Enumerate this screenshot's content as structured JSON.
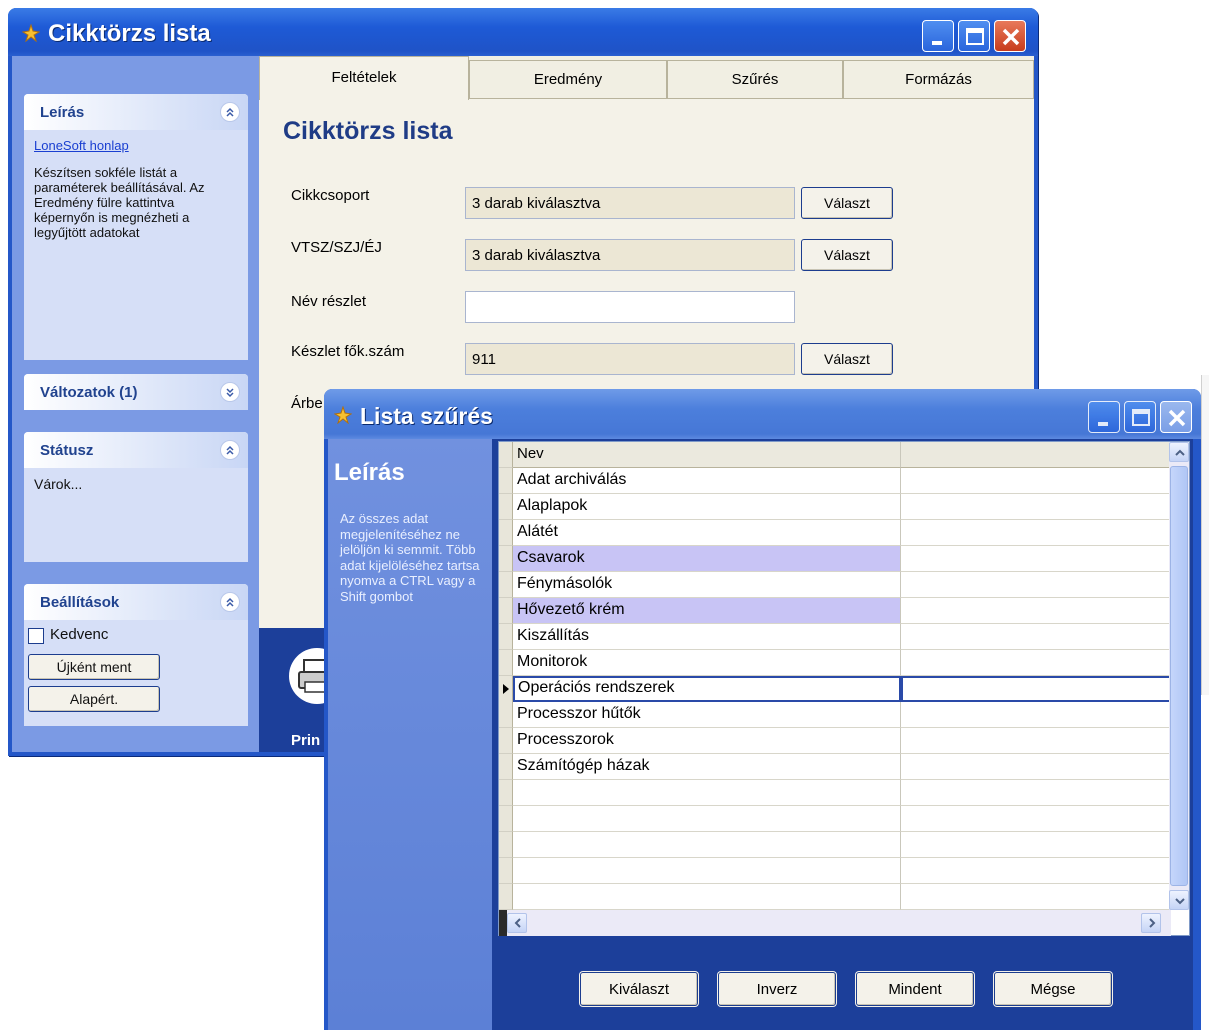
{
  "main_window": {
    "title": "Cikktörzs lista",
    "sidebar": {
      "leiras": {
        "title": "Leírás",
        "link": "LoneSoft honlap",
        "text": "Készítsen sokféle listát a paraméterek beállításával. Az Eredmény fülre kattintva képernyőn is megnézheti a legyűjtött adatokat"
      },
      "valtozatok": {
        "title": "Változatok (1)"
      },
      "statusz": {
        "title": "Státusz",
        "text": "Várok..."
      },
      "beallitasok": {
        "title": "Beállítások",
        "checkbox_label": "Kedvenc",
        "checkbox_checked": false,
        "save_new_label": "Újként ment",
        "default_label": "Alapért."
      }
    },
    "tabs": [
      "Feltételek",
      "Eredmény",
      "Szűrés",
      "Formázás"
    ],
    "active_tab": "Feltételek",
    "page_title": "Cikktörzs lista",
    "fields": [
      {
        "label": "Cikkcsoport",
        "value": "3 darab kiválasztva",
        "button": "Választ"
      },
      {
        "label": "VTSZ/SZJ/ÉJ",
        "value": "3 darab kiválasztva",
        "button": "Választ"
      },
      {
        "label": "Név részlet",
        "value": ""
      },
      {
        "label": "Készlet fők.szám",
        "value": "911",
        "button": "Választ"
      },
      {
        "label": "Árbe"
      }
    ],
    "print_label": "Prin"
  },
  "dialog": {
    "title": "Lista szűrés",
    "left_title": "Leírás",
    "left_text": "Az összes adat megjelenítéséhez ne jelöljön ki semmit. Több adat kijelöléséhez tartsa nyomva a CTRL vagy a Shift gombot",
    "grid_header": "Nev",
    "rows": [
      {
        "name": "Adat archiválás",
        "selected": false,
        "current": false
      },
      {
        "name": "Alaplapok",
        "selected": false,
        "current": false
      },
      {
        "name": "Alátét",
        "selected": false,
        "current": false
      },
      {
        "name": "Csavarok",
        "selected": true,
        "current": false
      },
      {
        "name": "Fénymásolók",
        "selected": false,
        "current": false
      },
      {
        "name": "Hővezető krém",
        "selected": true,
        "current": false
      },
      {
        "name": "Kiszállítás",
        "selected": false,
        "current": false
      },
      {
        "name": "Monitorok",
        "selected": false,
        "current": false
      },
      {
        "name": "Operációs rendszerek",
        "selected": false,
        "current": true
      },
      {
        "name": "Processzor hűtők",
        "selected": false,
        "current": false
      },
      {
        "name": "Processzorok",
        "selected": false,
        "current": false
      },
      {
        "name": "Számítógép házak",
        "selected": false,
        "current": false
      }
    ],
    "buttons": [
      "Kiválaszt",
      "Inverz",
      "Mindent",
      "Mégse"
    ]
  },
  "colors": {
    "titlebar": "#1e5ad6",
    "selection": "#c8c4f5",
    "panel_header_text": "#21438f"
  },
  "icons": [
    "app-icon",
    "minimize-icon",
    "maximize-icon",
    "close-icon",
    "collapse-icon",
    "expand-icon",
    "printer-icon",
    "row-pointer-icon",
    "scroll-up-icon",
    "scroll-down-icon",
    "scroll-left-icon",
    "scroll-right-icon"
  ]
}
